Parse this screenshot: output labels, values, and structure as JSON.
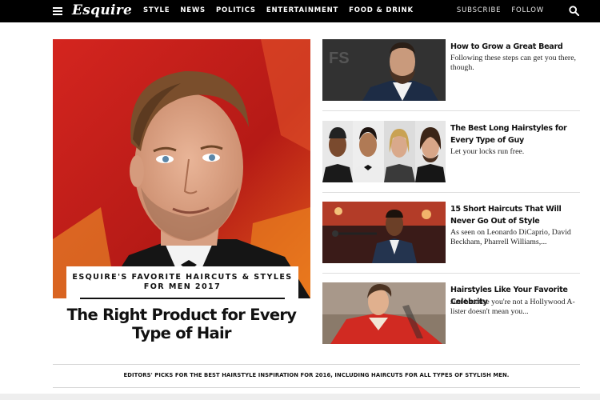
{
  "nav": {
    "logo": "Esquire",
    "items": [
      "STYLE",
      "NEWS",
      "POLITICS",
      "ENTERTAINMENT",
      "FOOD & DRINK"
    ],
    "subscribe": "SUBSCRIBE",
    "follow": "FOLLOW"
  },
  "hero": {
    "kicker": "ESQUIRE'S FAVORITE HAIRCUTS & STYLES FOR MEN 2017",
    "title": "The Right Product for Every Type of Hair"
  },
  "stories": [
    {
      "headline": "How to Grow a Great Beard",
      "dek": "Following these steps can get you there, though."
    },
    {
      "headline": "The Best Long Hairstyles for Every Type of Guy",
      "dek": "Let your locks run free."
    },
    {
      "headline": "15 Short Haircuts That Will Never Go Out of Style",
      "dek": "As seen on Leonardo DiCaprio, David Beckham, Pharrell Williams,..."
    },
    {
      "headline": "Hairstyles Like Your Favorite Celebrity",
      "dek": "Just because you're not a Hollywood A-lister doesn't mean you..."
    }
  ],
  "footer": {
    "text": "EDITORS' PICKS FOR THE BEST HAIRSTYLE INSPIRATION FOR 2016, INCLUDING HAIRCUTS FOR ALL TYPES OF STYLISH MEN."
  },
  "colors": {
    "nav_bg": "#000000",
    "hero_bg": "#c4211c",
    "text": "#111111",
    "divider": "#dddddd"
  }
}
